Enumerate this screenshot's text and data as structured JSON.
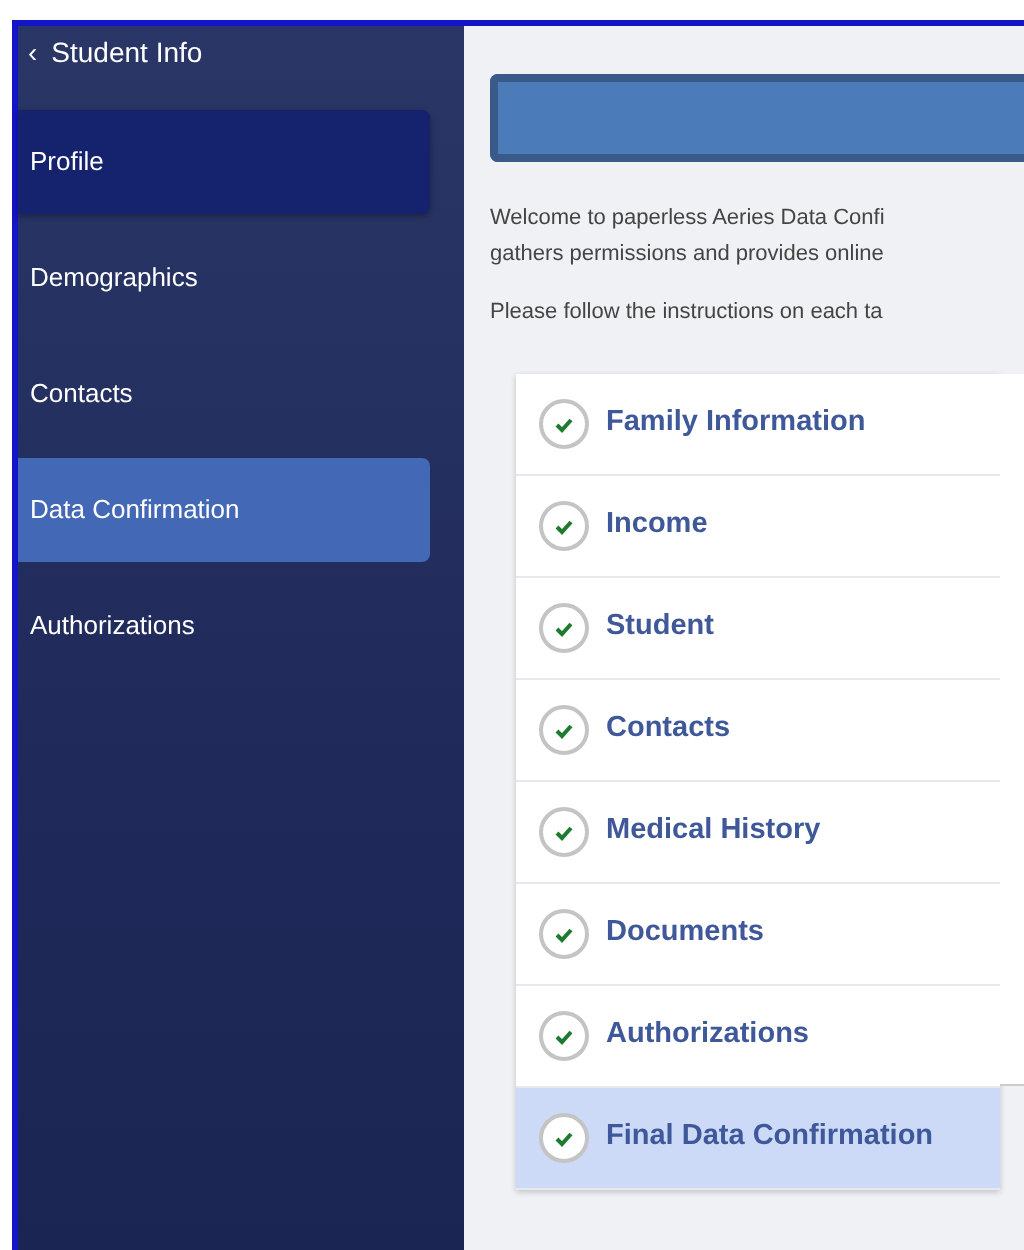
{
  "sidebar": {
    "back_link": {
      "icon": "‹",
      "label": "Student Info"
    },
    "items": [
      {
        "label": "Profile",
        "selected": false,
        "highlighted": true
      },
      {
        "label": "Demographics",
        "selected": false,
        "highlighted": false
      },
      {
        "label": "Contacts",
        "selected": false,
        "highlighted": false
      },
      {
        "label": "Data Confirmation",
        "selected": true,
        "highlighted": false
      },
      {
        "label": "Authorizations",
        "selected": false,
        "highlighted": false
      }
    ]
  },
  "intro": [
    "Welcome to paperless Aeries Data Confi",
    "gathers permissions and provides online",
    "Please follow the instructions on each ta"
  ],
  "steps": [
    {
      "label": "Family Information",
      "completed": true,
      "selected": false
    },
    {
      "label": "Income",
      "completed": true,
      "selected": false
    },
    {
      "label": "Student",
      "completed": true,
      "selected": false
    },
    {
      "label": "Contacts",
      "completed": true,
      "selected": false
    },
    {
      "label": "Medical History",
      "completed": true,
      "selected": false
    },
    {
      "label": "Documents",
      "completed": true,
      "selected": false
    },
    {
      "label": "Authorizations",
      "completed": true,
      "selected": false
    },
    {
      "label": "Final Data Confirmation",
      "completed": true,
      "selected": true
    }
  ]
}
